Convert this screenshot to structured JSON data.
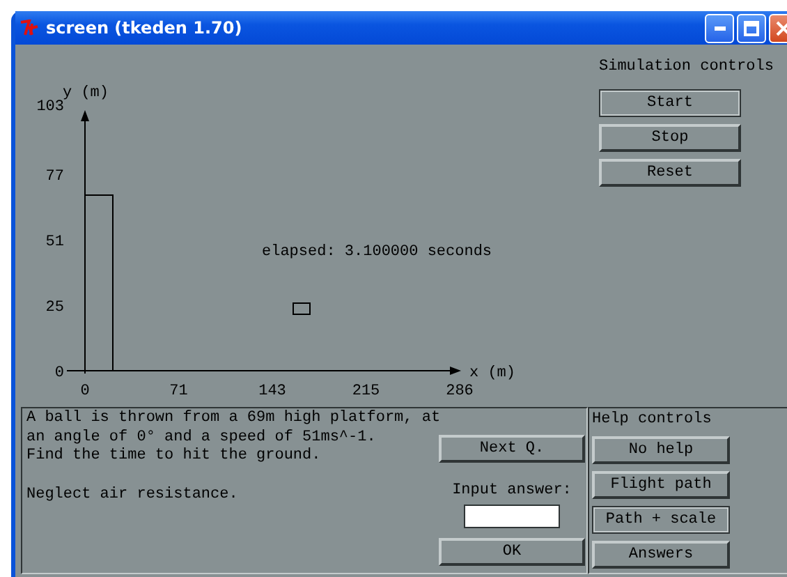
{
  "window": {
    "title": "screen (tkeden 1.70)"
  },
  "plot": {
    "y_axis_label": "y (m)",
    "x_axis_label": "x (m)",
    "y_ticks": [
      "103",
      "77",
      "51",
      "25",
      "0"
    ],
    "x_ticks": [
      "0",
      "71",
      "143",
      "215",
      "286"
    ],
    "elapsed": "elapsed: 3.100000 seconds"
  },
  "simulation_controls": {
    "heading": "Simulation controls",
    "buttons": [
      {
        "label": "Start",
        "selected": true
      },
      {
        "label": "Stop",
        "selected": false
      },
      {
        "label": "Reset",
        "selected": false
      }
    ]
  },
  "question": {
    "text": "A ball is thrown from a 69m high platform, at\nan angle of 0° and a speed of 51ms^-1.\nFind the time to hit the ground.",
    "note": "Neglect air resistance.",
    "next_button": "Next Q.",
    "answer_label": "Input answer:",
    "ok_button": "OK"
  },
  "help_controls": {
    "heading": "Help controls",
    "buttons": [
      {
        "label": "No help",
        "selected": false
      },
      {
        "label": "Flight path",
        "selected": false
      },
      {
        "label": "Path + scale",
        "selected": true
      },
      {
        "label": "Answers",
        "selected": false
      }
    ]
  }
}
